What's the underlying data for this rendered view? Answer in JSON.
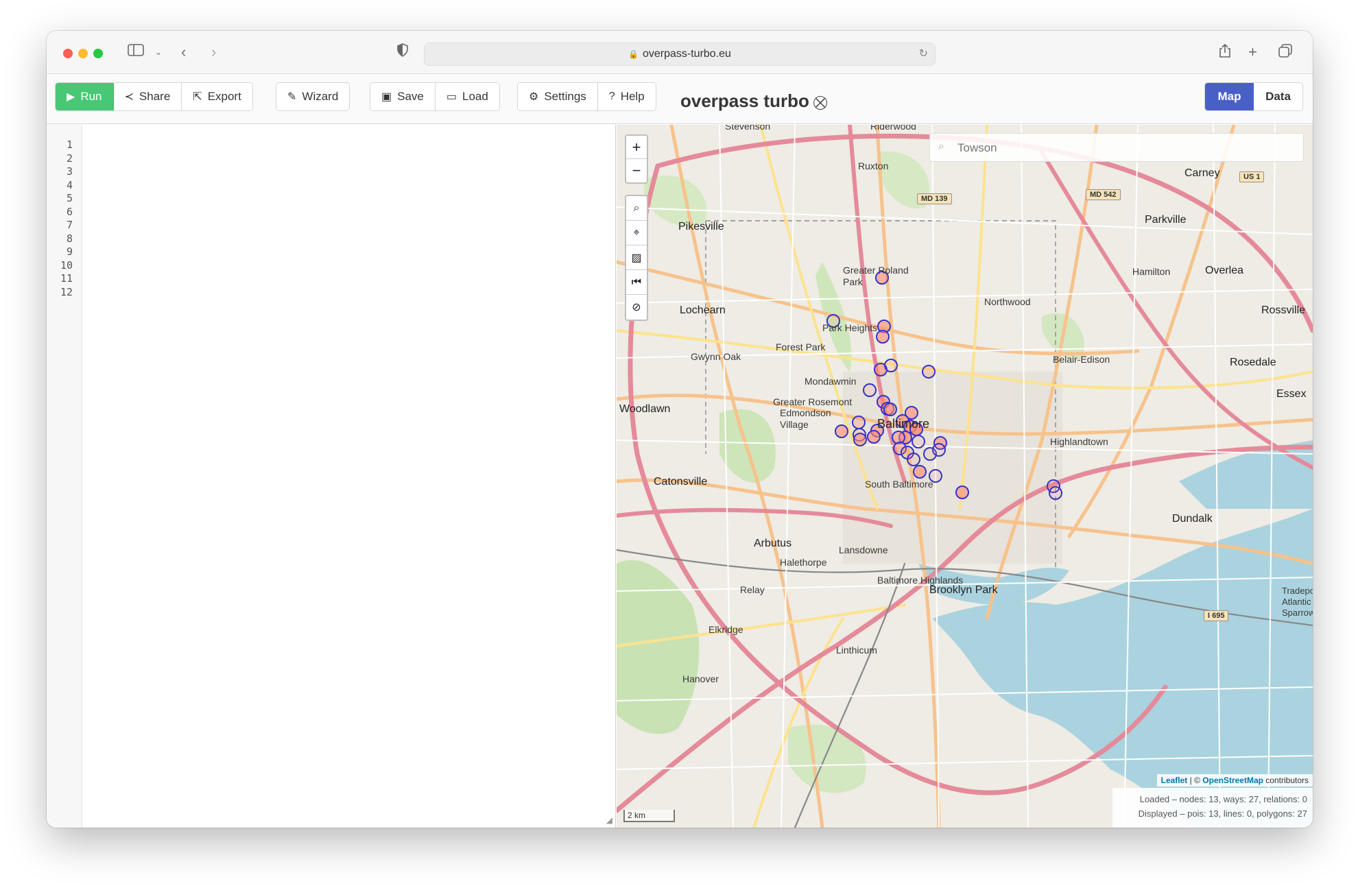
{
  "browser": {
    "url": "overpass-turbo.eu"
  },
  "toolbar": {
    "run": "Run",
    "share": "Share",
    "export": "Export",
    "wizard": "Wizard",
    "save": "Save",
    "load": "Load",
    "settings": "Settings",
    "help": "Help",
    "brand": "overpass turbo",
    "view_map": "Map",
    "view_data": "Data"
  },
  "editor": {
    "line_numbers": [
      "1",
      "2",
      "3",
      "4",
      "5",
      "6",
      "7",
      "8",
      "9",
      "10",
      "11",
      "12"
    ]
  },
  "map": {
    "search_placeholder": "Towson",
    "scale": "2 km",
    "attribution_leaflet": "Leaflet",
    "attribution_sep": " | © ",
    "attribution_osm": "OpenStreetMap",
    "attribution_tail": " contributors",
    "stats_loaded": "Loaded – nodes: 13, ways: 27, relations: 0",
    "stats_displayed": "Displayed – pois: 13, lines: 0, polygons: 27",
    "labels": {
      "stevenson": "Stevenson",
      "riderwood": "Riderwood",
      "ruxton": "Ruxton",
      "carney": "Carney",
      "pikesville": "Pikesville",
      "parkville": "Parkville",
      "greater_roland_park": "Greater Roland Park",
      "hamilton": "Hamilton",
      "overlea": "Overlea",
      "lochearn": "Lochearn",
      "northwood": "Northwood",
      "rossville": "Rossville",
      "park_heights": "Park Heights",
      "forest_park": "Forest Park",
      "belair_edison": "Belair-Edison",
      "gwynn_oak": "Gwynn Oak",
      "rosedale": "Rosedale",
      "mondawmin": "Mondawmin",
      "essex": "Essex",
      "woodlawn": "Woodlawn",
      "greater_rosemont": "Greater Rosemont",
      "edmondson_village": "Edmondson Village",
      "baltimore": "Baltimore",
      "highlandtown": "Highlandtown",
      "catonsville": "Catonsville",
      "south_baltimore": "South Baltimore",
      "dundalk": "Dundalk",
      "arbutus": "Arbutus",
      "lansdowne": "Lansdowne",
      "halethorpe": "Halethorpe",
      "baltimore_highlands": "Baltimore Highlands",
      "brooklyn_park": "Brooklyn Park",
      "relay": "Relay",
      "elkridge": "Elkridge",
      "linthicum": "Linthicum",
      "hanover": "Hanover",
      "sparrows": "Tradepoint Atlantic Sparrows",
      "md139": "MD 139",
      "md542": "MD 542",
      "us1": "US 1",
      "i695": "I 695"
    }
  },
  "colors": {
    "run_green": "#48c774",
    "map_active": "#485fc7",
    "poi_stroke": "#3333cc",
    "poi_fill": "#ff6f50"
  }
}
